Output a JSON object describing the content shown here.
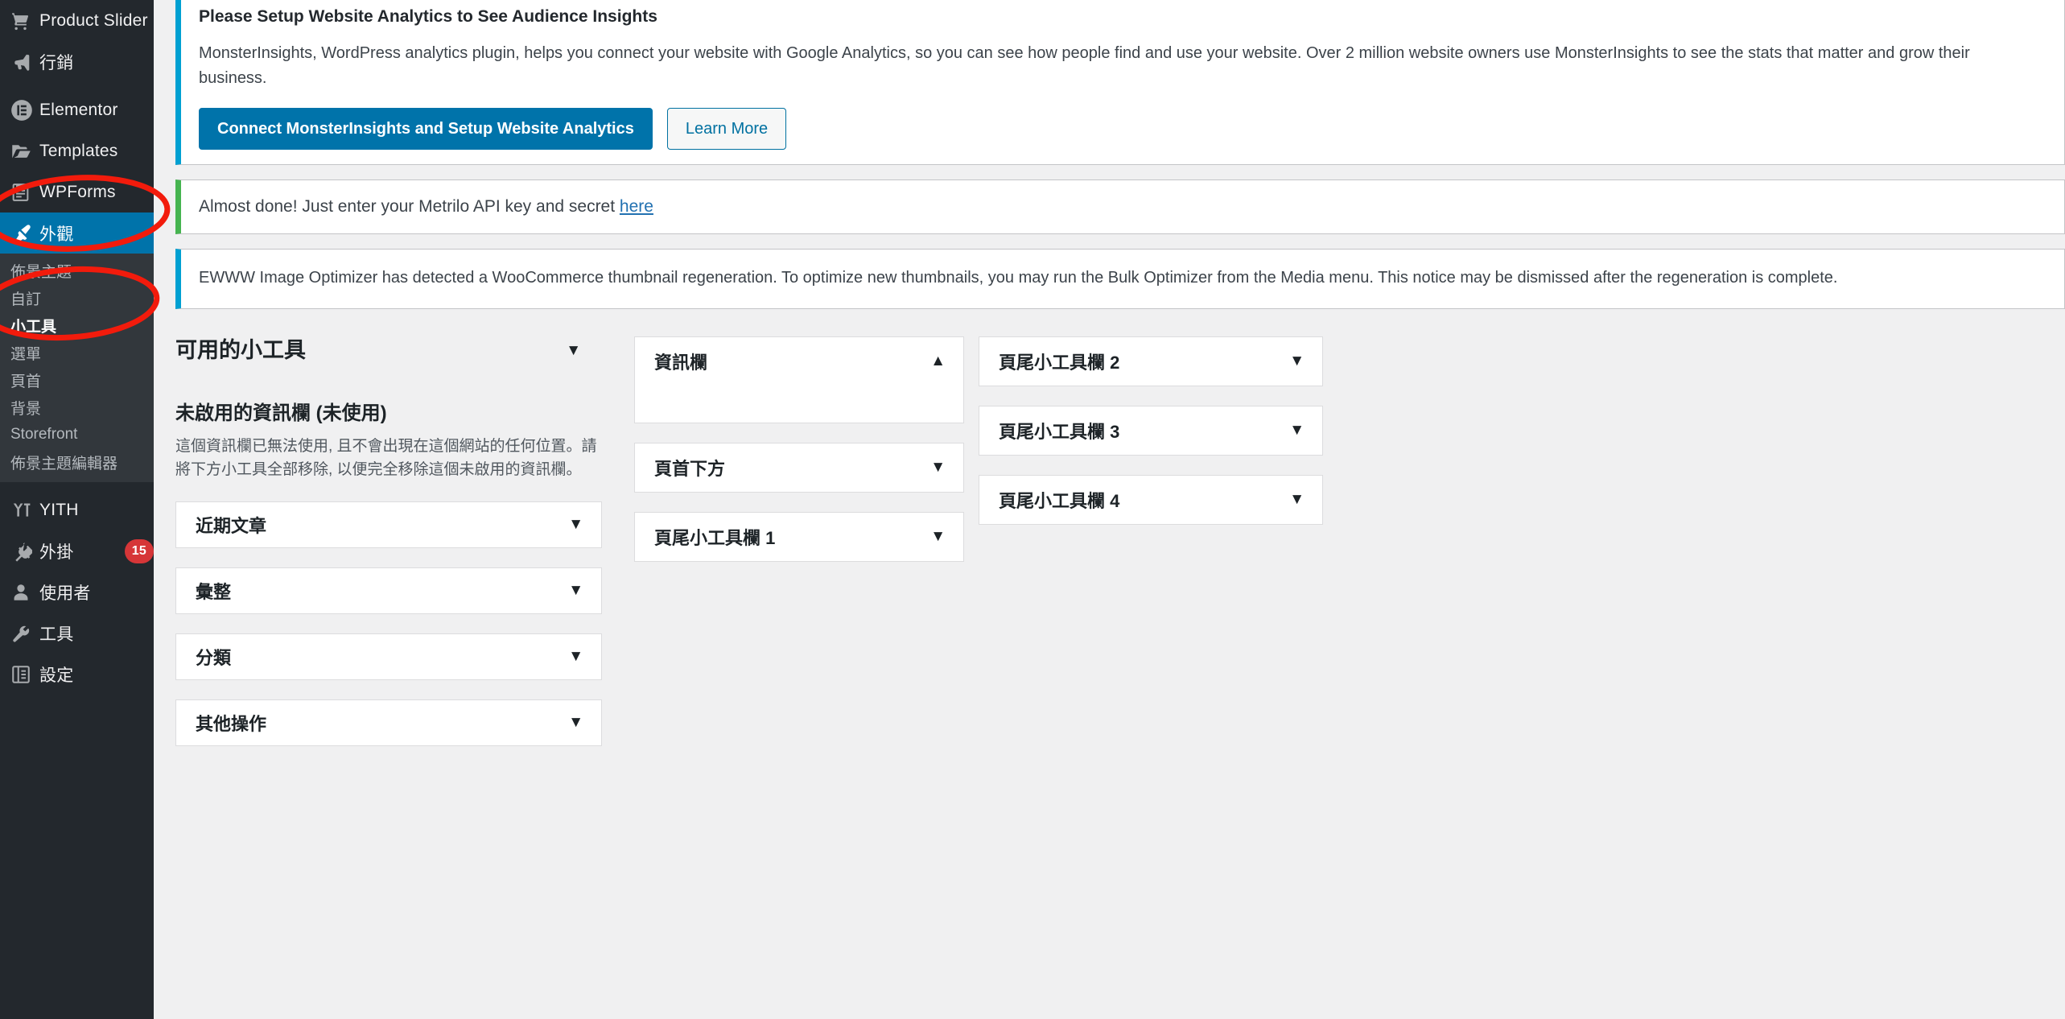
{
  "sidebar": {
    "items": [
      {
        "label": "Product Slider",
        "icon": "cart-icon",
        "state": "normal"
      },
      {
        "label": "行銷",
        "icon": "megaphone-icon",
        "state": "normal"
      },
      {
        "label": "Elementor",
        "icon": "elementor-icon",
        "state": "normal"
      },
      {
        "label": "Templates",
        "icon": "folder-icon",
        "state": "normal"
      },
      {
        "label": "WPForms",
        "icon": "form-icon",
        "state": "normal"
      },
      {
        "label": "外觀",
        "icon": "paintbrush-icon",
        "state": "current"
      }
    ],
    "submenu": [
      {
        "label": "佈景主題",
        "active": false
      },
      {
        "label": "自訂",
        "active": false
      },
      {
        "label": "小工具",
        "active": true
      },
      {
        "label": "選單",
        "active": false
      },
      {
        "label": "頁首",
        "active": false
      },
      {
        "label": "背景",
        "active": false
      },
      {
        "label": "Storefront",
        "active": false
      },
      {
        "label": "佈景主題編輯器",
        "active": false
      }
    ],
    "items_after": [
      {
        "label": "YITH",
        "icon": "yith-icon",
        "badge": null
      },
      {
        "label": "外掛",
        "icon": "plug-icon",
        "badge": "15"
      },
      {
        "label": "使用者",
        "icon": "user-icon",
        "badge": null
      },
      {
        "label": "工具",
        "icon": "wrench-icon",
        "badge": null
      },
      {
        "label": "設定",
        "icon": "settings-icon",
        "badge": null
      }
    ]
  },
  "notices": {
    "monsterinsights": {
      "title": "Please Setup Website Analytics to See Audience Insights",
      "body": "MonsterInsights, WordPress analytics plugin, helps you connect your website with Google Analytics, so you can see how people find and use your website. Over 2 million website owners use MonsterInsights to see the stats that matter and grow their business.",
      "primary_button": "Connect MonsterInsights and Setup Website Analytics",
      "secondary_button": "Learn More"
    },
    "metrilo": {
      "text_before": "Almost done! Just enter your Metrilo API key and secret ",
      "link": "here"
    },
    "ewww": {
      "body": "EWWW Image Optimizer has detected a WooCommerce thumbnail regeneration. To optimize new thumbnails, you may run the Bulk Optimizer from the Media menu. This notice may be dismissed after the regeneration is complete."
    }
  },
  "widgets": {
    "available_title": "可用的小工具",
    "available_caret": "▼",
    "inactive_sidebar_title": "未啟用的資訊欄 (未使用)",
    "inactive_sidebar_desc": "這個資訊欄已無法使用, 且不會出現在這個網站的任何位置。請將下方小工具全部移除, 以便完全移除這個未啟用的資訊欄。",
    "inactive_items": [
      {
        "label": "近期文章",
        "caret": "▼"
      },
      {
        "label": "彙整",
        "caret": "▼"
      },
      {
        "label": "分類",
        "caret": "▼"
      },
      {
        "label": "其他操作",
        "caret": "▼"
      }
    ],
    "middle_areas": [
      {
        "label": "資訊欄",
        "caret": "▲",
        "expanded": true
      },
      {
        "label": "頁首下方",
        "caret": "▼",
        "expanded": false
      },
      {
        "label": "頁尾小工具欄 1",
        "caret": "▼",
        "expanded": false
      }
    ],
    "right_areas": [
      {
        "label": "頁尾小工具欄 2",
        "caret": "▼",
        "expanded": false
      },
      {
        "label": "頁尾小工具欄 3",
        "caret": "▼",
        "expanded": false
      },
      {
        "label": "頁尾小工具欄 4",
        "caret": "▼",
        "expanded": false
      }
    ]
  },
  "annotations": {
    "ellipse_appearance": "red-ellipse-around-appearance-menu",
    "ellipse_widgets": "red-ellipse-around-widgets-submenu",
    "color": "#f21b0c"
  }
}
